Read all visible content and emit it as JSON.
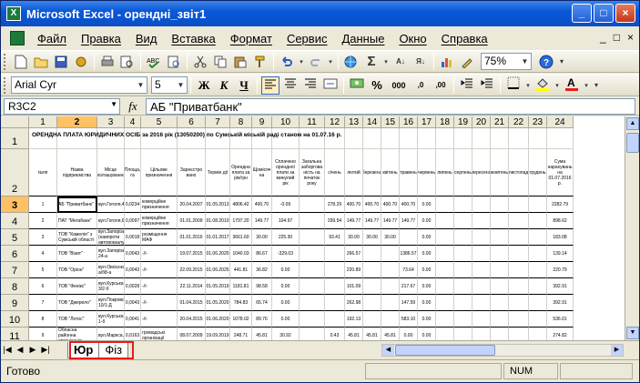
{
  "window": {
    "title": "Microsoft Excel - орендні_звіт1",
    "app_icon_letter": "X",
    "buttons": [
      "_",
      "□",
      "×"
    ]
  },
  "menu": {
    "items": [
      "Файл",
      "Правка",
      "Вид",
      "Вставка",
      "Формат",
      "Сервис",
      "Данные",
      "Окно",
      "Справка"
    ],
    "right_buttons": [
      "_",
      "□",
      "×"
    ]
  },
  "toolbar1": {
    "zoom": "75%",
    "icons": [
      "new-icon",
      "open-icon",
      "save-icon",
      "permission-icon",
      "print-icon",
      "print-preview-icon",
      "spelling-icon",
      "research-icon",
      "cut-icon",
      "copy-icon",
      "paste-icon",
      "format-painter-icon",
      "undo-icon",
      "redo-icon",
      "hyperlink-icon",
      "autosum-icon",
      "sort-asc-icon",
      "sort-desc-icon",
      "chart-wizard-icon",
      "drawing-icon",
      "help-icon"
    ]
  },
  "toolbar2": {
    "font_name": "Arial Cyr",
    "font_size": "5",
    "bold": "Ж",
    "italic": "К",
    "underline": "Ч",
    "percent": "%",
    "thousands": "000",
    "inc_decimal": ",0",
    "dec_decimal": ",00"
  },
  "formula_bar": {
    "name_box": "R3C2",
    "fx": "fx",
    "formula": "АБ \"Приватбанк\""
  },
  "grid": {
    "columns": [
      "1",
      "2",
      "3",
      "4",
      "5",
      "6",
      "7",
      "8",
      "9",
      "10",
      "11",
      "12",
      "13",
      "14",
      "15",
      "16",
      "17",
      "18",
      "19",
      "20",
      "21",
      "22",
      "23",
      "24"
    ],
    "selected_column": "2",
    "rows": [
      "1",
      "2",
      "3",
      "4",
      "5",
      "6",
      "7",
      "8",
      "9",
      "10",
      "11"
    ],
    "selected_row": "3",
    "title_text": "ОРЕНДНА ПЛАТА ЮРИДИЧНИХ ОСІБ за 2016 рік (13050200) по Сумській міській раді станом на 01.07.16 р.",
    "headers": [
      "№пп",
      "Назва підприємства",
      "Місце розташування",
      "Площа, га",
      "Цільове призначення",
      "Зареєстро вано",
      "Термін дії",
      "Орендна плата за рік/грн",
      "Щомісяч на",
      "Сплачено орендної плати за минулий рік",
      "Загальна заборгова ність на початок року",
      "січень",
      "лютий",
      "березень",
      "квітень",
      "травень",
      "червень",
      "липень",
      "серпень",
      "вересень",
      "жовтень",
      "листопад",
      "грудень",
      "Сума нарахувань на 01.07.2016 р."
    ],
    "data_rows": [
      [
        "1",
        "АБ \"Приватбанк\"",
        "вул.Гоголя,4",
        "0,0234",
        "комерційне призначення",
        "20.04.2007",
        "01.05.2013",
        "4806.42",
        "400.70",
        "-0.09",
        "",
        "278.29",
        "400.70",
        "400.70",
        "400.70",
        "400.70",
        "0.00",
        "",
        "",
        "",
        "",
        "",
        "",
        "2282.79"
      ],
      [
        "2",
        "ПАТ \"Мегабанк\"",
        "вул.Гоголя,6",
        "0,0097",
        "комерційне призначення",
        "01.01.2009",
        "01.08.2010",
        "1797.20",
        "149.77",
        "104.97",
        "",
        "299.54",
        "149.77",
        "149.77",
        "149.77",
        "149.77",
        "0.00",
        "",
        "",
        "",
        "",
        "",
        "",
        "898.62"
      ],
      [
        "3",
        "ТОВ \"Камелія\" з Сумській області",
        "вул.Запорізька (навпроти автовокзалу)",
        "0,0018",
        "розміщення МАФ",
        "01.01.2016",
        "01.01.2017",
        "3661.60",
        "30.00",
        "225.30",
        "",
        "93.41",
        "30.00",
        "30.00",
        "30.00",
        "",
        "0.00",
        "",
        "",
        "",
        "",
        "",
        "",
        "183.08"
      ],
      [
        "4",
        "ТОВ \"Візит\"",
        "вул.Запорізька 24-а",
        "0,0043",
        "-//-",
        "19.07.2015",
        "01.06.2020",
        "1040.03",
        "86.67",
        "-329.03",
        "",
        "",
        "266.57",
        "",
        "",
        "1386.57",
        "0.00",
        "",
        "",
        "",
        "",
        "",
        "",
        "139.14"
      ],
      [
        "5",
        "ТОВ \"Оріон\"",
        "вул.Овсієнка, а/б8-а",
        "0,0043",
        "-//-",
        "22.09.2015",
        "01.06.2025",
        "441.81",
        "36.82",
        "0.00",
        "",
        "",
        "220.89",
        "",
        "",
        "73.64",
        "0.00",
        "",
        "",
        "",
        "",
        "",
        "",
        "220.79"
      ],
      [
        "6",
        "ТОВ \"Фенікс\"",
        "вул.Курська, 3/2-б",
        "0,0028",
        "-//-",
        "22.11.2014",
        "01.05.2019",
        "1181.81",
        "98.58",
        "0.00",
        "",
        "",
        "101.09",
        "",
        "",
        "217.67",
        "0.00",
        "",
        "",
        "",
        "",
        "",
        "",
        "392.91"
      ],
      [
        "7",
        "ТОВ \"Джерело\"",
        "вул.Покровська 10/1-Д",
        "0,0043",
        "-//-",
        "01.04.2015",
        "01.05.2020",
        "784.83",
        "65.74",
        "0.00",
        "",
        "",
        "262.98",
        "",
        "",
        "147.59",
        "0.00",
        "",
        "",
        "",
        "",
        "",
        "",
        "392.91"
      ],
      [
        "8",
        "ТОВ \"Лотос\"",
        "вул.Курська 1-б",
        "0,0041",
        "-//-",
        "20.04.2015",
        "01.06.2020",
        "1078.02",
        "89.76",
        "0.00",
        "",
        "",
        "192.13",
        "",
        "",
        "583.10",
        "0.00",
        "",
        "",
        "",
        "",
        "",
        "",
        "536.01"
      ],
      [
        "9",
        "Обласна районна організація",
        "вул.Маркса,15",
        "0,0163",
        "громадські організації",
        "08.07.2009",
        "19.09.2019",
        "248.71",
        "45.81",
        "30.92",
        "",
        "0.43",
        "45.81",
        "45.81",
        "45.81",
        "0.00",
        "0.00",
        "",
        "",
        "",
        "",
        "",
        "",
        "274.82"
      ]
    ]
  },
  "sheets": [
    "Юр",
    "Фіз"
  ],
  "active_sheet": "Юр",
  "status": {
    "ready": "Готово",
    "num": "NUM"
  }
}
